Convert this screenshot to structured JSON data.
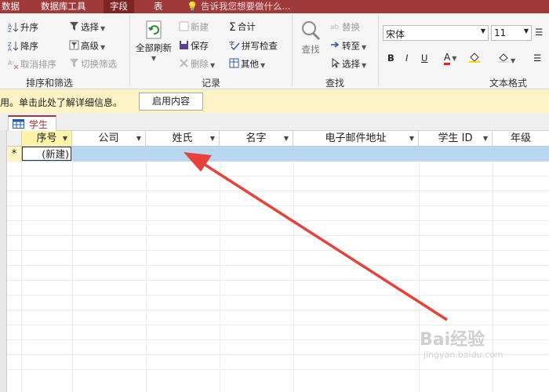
{
  "topbar": {
    "tabs": [
      {
        "label": "数据"
      },
      {
        "label": "数据库工具"
      },
      {
        "label": "字段"
      },
      {
        "label": "表"
      }
    ],
    "tell_me": "告诉我您想要做什么..."
  },
  "ribbon": {
    "sort_filter": {
      "ascending": "升序",
      "descending": "降序",
      "remove_sort": "取消排序",
      "selection": "选择",
      "advanced": "高级",
      "toggle_filter": "切换筛选",
      "label": "排序和筛选"
    },
    "records": {
      "refresh_all": "全部刷新",
      "new": "新建",
      "save": "保存",
      "delete": "删除",
      "totals": "合计",
      "spelling": "拼写检查",
      "more": "其他",
      "label": "记录"
    },
    "find": {
      "find": "查找",
      "replace": "替换",
      "goto": "转至",
      "select": "选择",
      "label": "查找"
    },
    "text_format": {
      "font": "宋体",
      "size": "11",
      "bold": "B",
      "italic": "I",
      "underline": "U",
      "font_color_letter": "A",
      "label": "文本格式"
    }
  },
  "message_bar": {
    "text": "用。单击此处了解详细信息。",
    "button": "启用内容"
  },
  "doc_tab": {
    "label": "学生"
  },
  "table": {
    "columns": [
      "序号",
      "公司",
      "姓氏",
      "名字",
      "电子邮件地址",
      "学生 ID",
      "年级"
    ],
    "new_row_marker": "*",
    "new_row_text": "(新建)"
  },
  "watermark": {
    "text": "Bai经验",
    "sub": "jingyan.baidu.com"
  },
  "colors": {
    "accent": "#a4373a",
    "arrow": "#e8413c",
    "selection": "#b9d7f0"
  }
}
